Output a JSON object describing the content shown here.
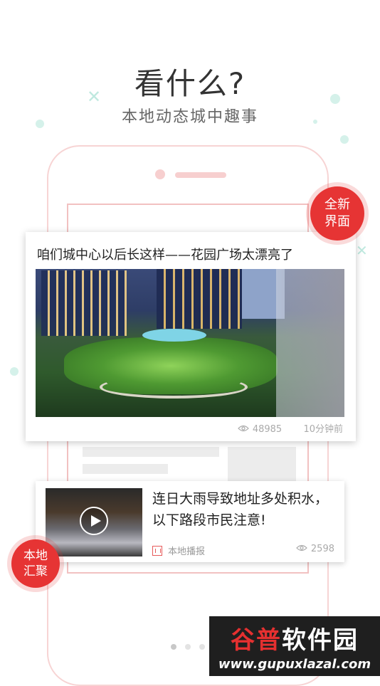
{
  "hero": {
    "title": "看什么?",
    "subtitle": "本地动态城中趣事"
  },
  "badges": {
    "new_line1": "全新",
    "new_line2": "界面",
    "local_line1": "本地",
    "local_line2": "汇聚"
  },
  "main_card": {
    "title": "咱们城中心以后长这样——花园广场太漂亮了",
    "views": "48985",
    "time": "10分钟前"
  },
  "sub_card": {
    "title": "连日大雨导致地址多处积水，以下路段市民注意!",
    "source": "本地播报",
    "views": "2598"
  },
  "watermark": {
    "logo_part1": "谷普",
    "logo_part2": "软件园",
    "url": "www.gupuxlazal.com"
  },
  "pager": {
    "count": 3,
    "active": 0
  },
  "colors": {
    "accent": "#e63434",
    "phone_outline": "#f7d4d4",
    "deco": "#bfe9df"
  }
}
